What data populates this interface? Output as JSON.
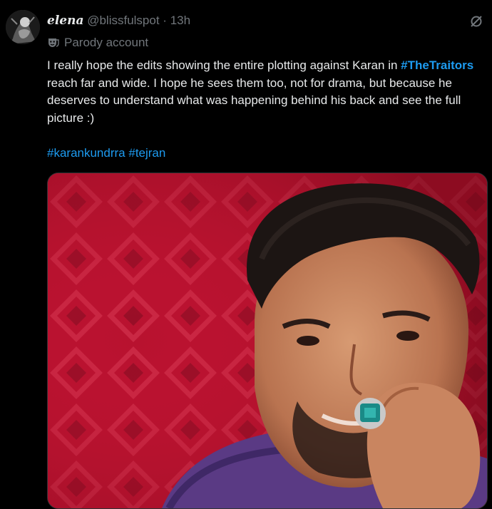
{
  "post": {
    "display_name": "elena",
    "handle": "@blissfulspot",
    "separator": "·",
    "time": "13h",
    "parody_label": "Parody account",
    "text_before": "I really hope the edits showing the entire plotting against Karan in ",
    "hashtag_main": "#TheTraitors",
    "text_after": " reach far and wide. I hope he sees them too, not for drama, but because he deserves to understand what was happening behind his back and see the full picture :)",
    "hashtag_1": "#karankundrra",
    "hashtag_2": "#tejran",
    "icons": {
      "grok": "grok-icon",
      "parody": "theater-mask-icon",
      "avatar": "avatar-image"
    },
    "colors": {
      "accent": "#1d9bf0",
      "muted": "#71767b",
      "text": "#e7e9ea",
      "background": "#000000"
    }
  }
}
